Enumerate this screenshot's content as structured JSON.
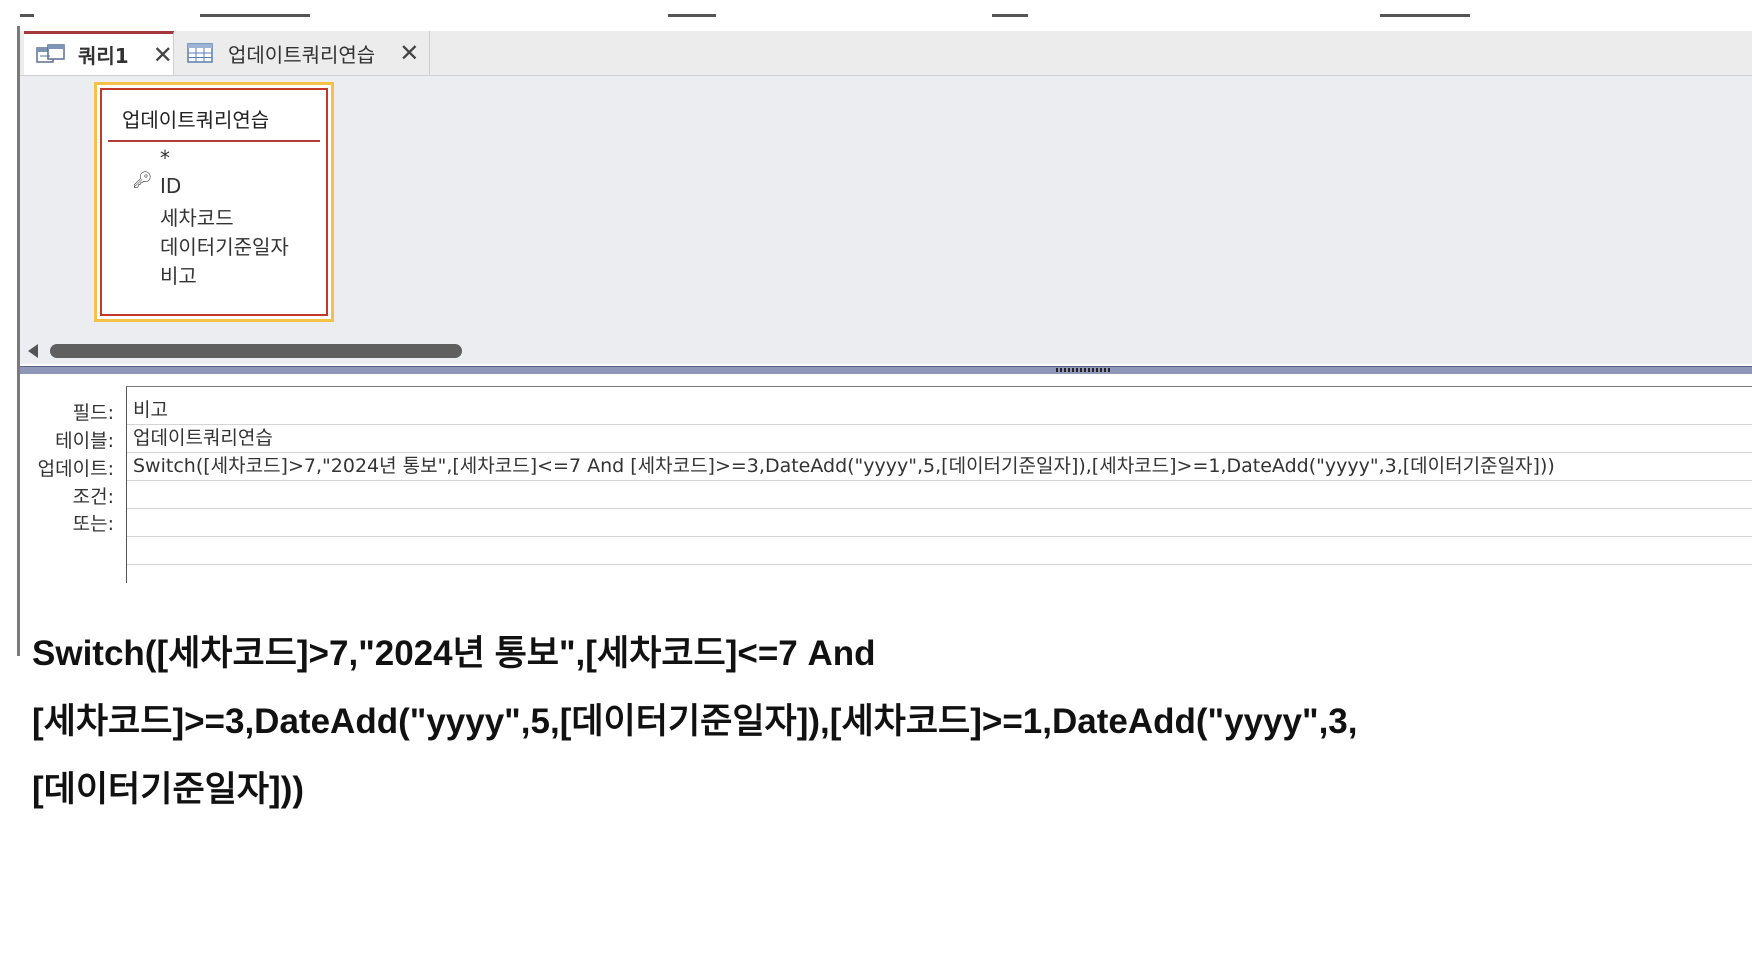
{
  "tabs": [
    {
      "label": "쿼리1",
      "icon": "query-design-icon",
      "active": true
    },
    {
      "label": "업데이트쿼리연습",
      "icon": "table-icon",
      "active": false
    }
  ],
  "table_box": {
    "title": "업데이트쿼리연습",
    "fields": [
      "*",
      "ID",
      "세차코드",
      "데이터기준일자",
      "비고"
    ],
    "key_field_icon": "primary-key-icon"
  },
  "grid": {
    "row_labels": {
      "field": "필드:",
      "table": "테이블:",
      "update": "업데이트:",
      "criteria": "조건:",
      "or": "또는:"
    },
    "values": {
      "field": "비고",
      "table": "업데이트쿼리연습",
      "update": "Switch([세차코드]>7,\"2024년 통보\",[세차코드]<=7 And [세차코드]>=3,DateAdd(\"yyyy\",5,[데이터기준일자]),[세차코드]>=1,DateAdd(\"yyyy\",3,[데이터기준일자]))",
      "criteria": "",
      "or": ""
    }
  },
  "caption": {
    "line1": "Switch([세차코드]>7,\"2024년 통보\",[세차코드]<=7 And",
    "line2": "[세차코드]>=3,DateAdd(\"yyyy\",5,[데이터기준일자]),[세차코드]>=1,DateAdd(\"yyyy\",3,",
    "line3": "[데이터기준일자]))"
  },
  "colors": {
    "active_tab_accent": "#a4373a",
    "table_box_highlight": "#f5c249",
    "table_box_border": "#c0392b",
    "splitter": "#8e97b8"
  }
}
